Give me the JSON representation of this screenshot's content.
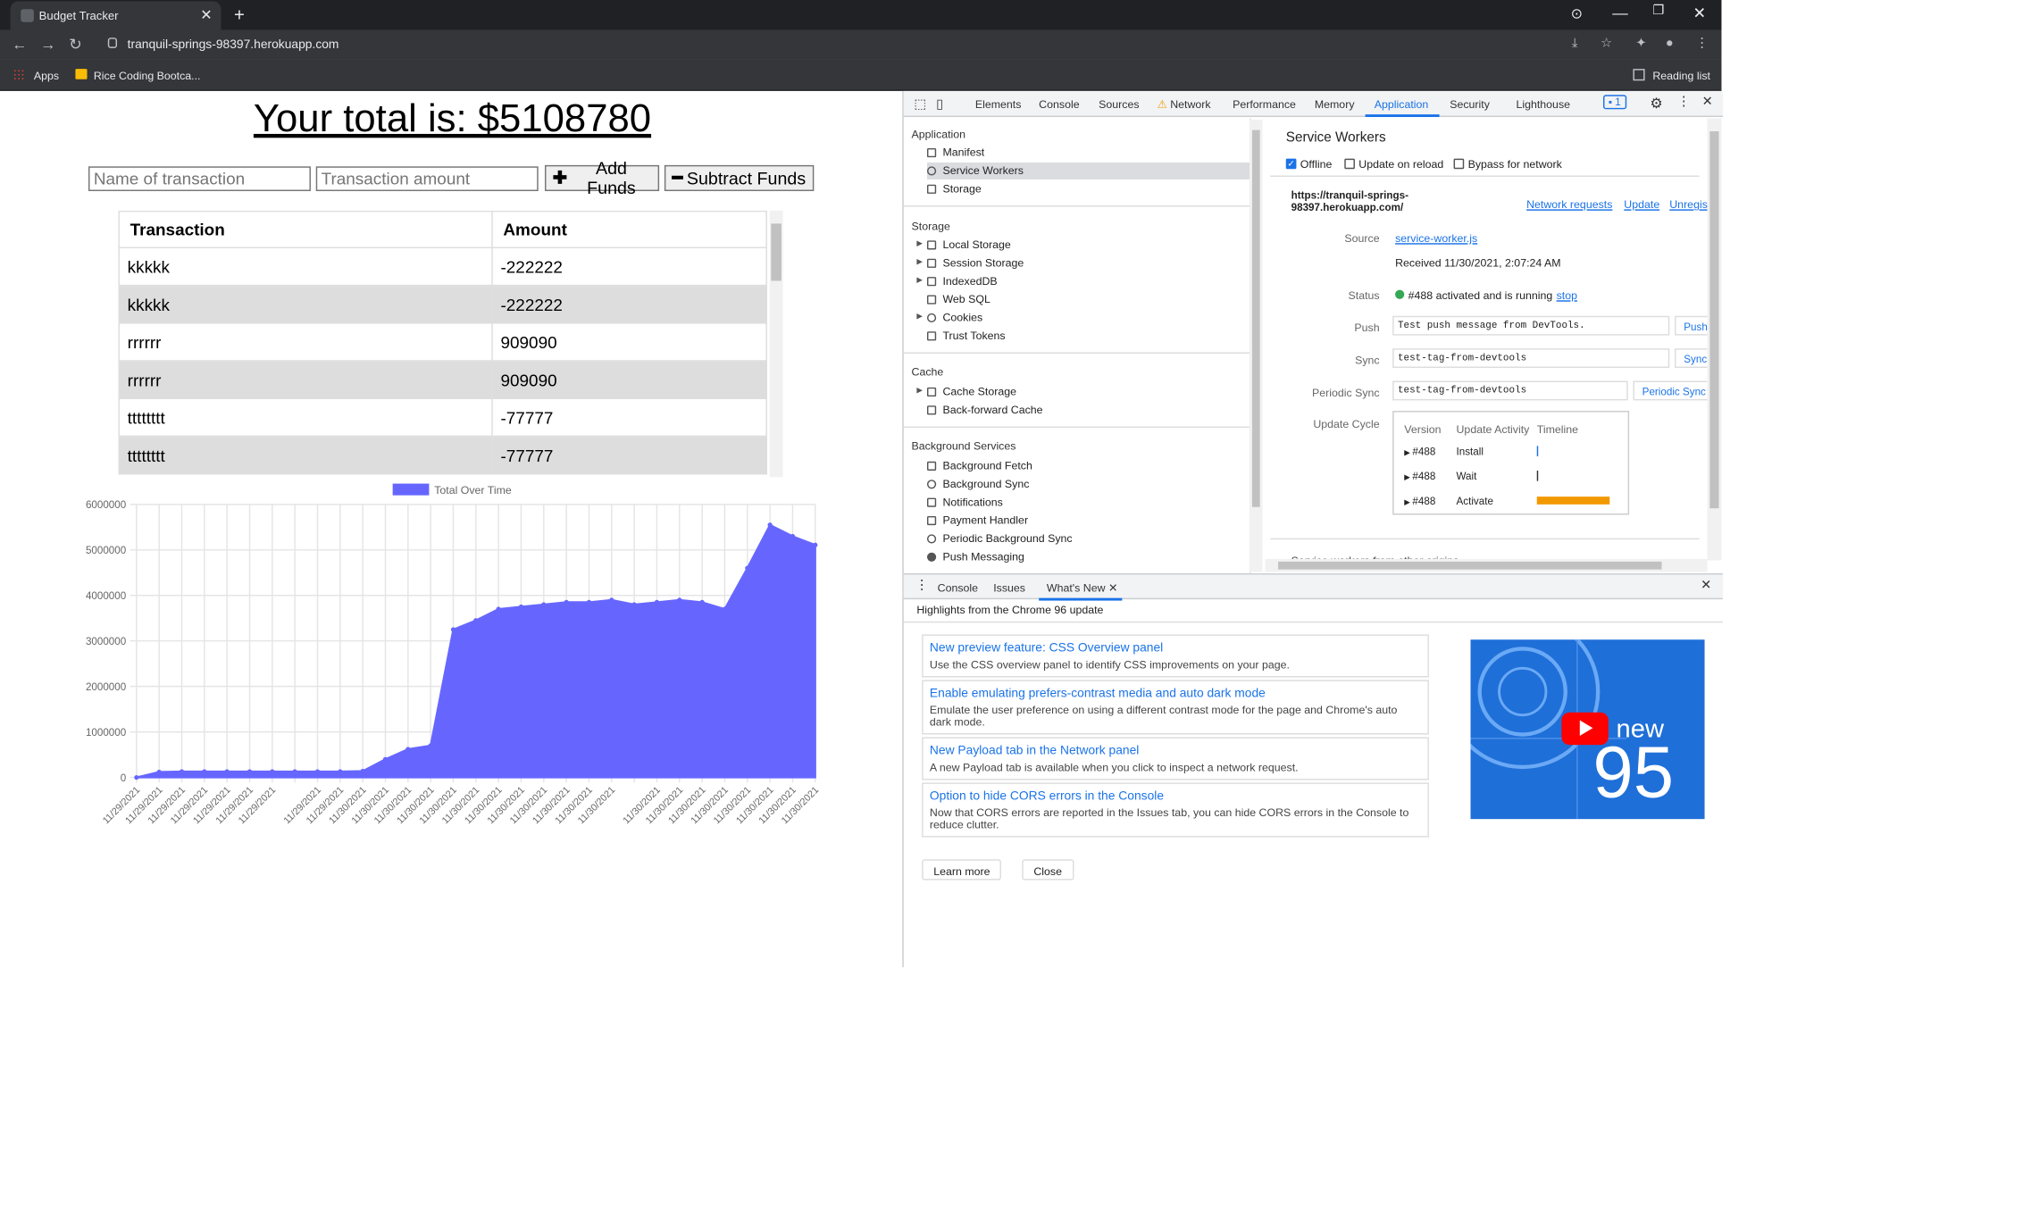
{
  "browser": {
    "tab_title": "Budget Tracker",
    "url": "tranquil-springs-98397.herokuapp.com",
    "bookmarks": {
      "apps": "Apps",
      "item": "Rice Coding Bootca...",
      "reading_list": "Reading list"
    }
  },
  "page": {
    "total_text": "Your total is: $5108780",
    "name_placeholder": "Name of transaction",
    "amount_placeholder": "Transaction amount",
    "add_label": "Add Funds",
    "subtract_label": "Subtract Funds",
    "table": {
      "headers": [
        "Transaction",
        "Amount"
      ],
      "rows": [
        {
          "name": "kkkkk",
          "amount": "-222222"
        },
        {
          "name": "kkkkk",
          "amount": "-222222"
        },
        {
          "name": "rrrrrr",
          "amount": "909090"
        },
        {
          "name": "rrrrrr",
          "amount": "909090"
        },
        {
          "name": "tttttttt",
          "amount": "-77777"
        },
        {
          "name": "tttttttt",
          "amount": "-77777"
        }
      ]
    }
  },
  "chart_data": {
    "type": "area",
    "legend": "Total Over Time",
    "legend_position": "top",
    "color": "#6666ff",
    "ylim": [
      0,
      6000000
    ],
    "yticks": [
      "0",
      "1000000",
      "2000000",
      "3000000",
      "4000000",
      "5000000",
      "6000000"
    ],
    "x": [
      "11/29/2021",
      "11/29/2021",
      "11/29/2021",
      "11/29/2021",
      "11/29/2021",
      "11/29/2021",
      "11/29/2021",
      "11/29/2021",
      "11/29/2021",
      "11/30/2021",
      "11/30/2021",
      "11/30/2021",
      "11/30/2021",
      "11/30/2021",
      "11/30/2021",
      "11/30/2021",
      "11/30/2021",
      "11/30/2021",
      "11/30/2021",
      "11/30/2021",
      "11/30/2021",
      "11/30/2021",
      "11/30/2021",
      "11/30/2021",
      "11/30/2021",
      "11/30/2021",
      "11/30/2021",
      "11/30/2021",
      "11/30/2021"
    ],
    "values": [
      0,
      120000,
      130000,
      130000,
      130000,
      130000,
      130000,
      130000,
      130000,
      130000,
      140000,
      400000,
      620000,
      700000,
      3250000,
      3450000,
      3700000,
      3750000,
      3800000,
      3850000,
      3850000,
      3900000,
      3800000,
      3850000,
      3900000,
      3850000,
      3700000,
      4600000,
      5550000,
      5300000,
      5108780
    ]
  },
  "devtools": {
    "tabs": [
      "Elements",
      "Console",
      "Sources",
      "Network",
      "Performance",
      "Memory",
      "Application",
      "Security",
      "Lighthouse"
    ],
    "issues_count": "1",
    "sidebar": {
      "application_header": "Application",
      "application_items": [
        "Manifest",
        "Service Workers",
        "Storage"
      ],
      "storage_header": "Storage",
      "storage_items": [
        "Local Storage",
        "Session Storage",
        "IndexedDB",
        "Web SQL",
        "Cookies",
        "Trust Tokens"
      ],
      "cache_header": "Cache",
      "cache_items": [
        "Cache Storage",
        "Back-forward Cache"
      ],
      "bg_header": "Background Services",
      "bg_items": [
        "Background Fetch",
        "Background Sync",
        "Notifications",
        "Payment Handler",
        "Periodic Background Sync",
        "Push Messaging"
      ]
    },
    "sw": {
      "title": "Service Workers",
      "offline": "Offline",
      "update_on_reload": "Update on reload",
      "bypass": "Bypass for network",
      "origin_line1": "https://tranquil-springs-",
      "origin_line2": "98397.herokuapp.com/",
      "network_requests": "Network requests",
      "update": "Update",
      "unregister": "Unregis",
      "source_label": "Source",
      "source_value": "service-worker.js",
      "received": "Received 11/30/2021, 2:07:24 AM",
      "status_label": "Status",
      "status_value": "#488 activated and is running",
      "stop": "stop",
      "push_label": "Push",
      "push_value": "Test push message from DevTools.",
      "push_btn": "Push",
      "sync_label": "Sync",
      "sync_value": "test-tag-from-devtools",
      "sync_btn": "Sync",
      "psync_label": "Periodic Sync",
      "psync_value": "test-tag-from-devtools",
      "psync_btn": "Periodic Sync",
      "cycle_label": "Update Cycle",
      "cycle_headers": [
        "Version",
        "Update Activity",
        "Timeline"
      ],
      "cycle_rows": [
        {
          "version": "#488",
          "activity": "Install"
        },
        {
          "version": "#488",
          "activity": "Wait"
        },
        {
          "version": "#488",
          "activity": "Activate"
        }
      ],
      "other_origins": "Service workers from other origins"
    },
    "drawer": {
      "tabs": [
        "Console",
        "Issues",
        "What's New"
      ],
      "highlights": "Highlights from the Chrome 96 update",
      "items": [
        {
          "title": "New preview feature: CSS Overview panel",
          "desc": "Use the CSS overview panel to identify CSS improvements on your page."
        },
        {
          "title": "Enable emulating prefers-contrast media and auto dark mode",
          "desc": "Emulate the user preference on using a different contrast mode for the page and Chrome's auto dark mode."
        },
        {
          "title": "New Payload tab in the Network panel",
          "desc": "A new Payload tab is available when you click to inspect a network request."
        },
        {
          "title": "Option to hide CORS errors in the Console",
          "desc": "Now that CORS errors are reported in the Issues tab, you can hide CORS errors in the Console to reduce clutter."
        }
      ],
      "promo_new": "new",
      "promo_num": "95",
      "learn_more": "Learn more",
      "close": "Close"
    }
  }
}
